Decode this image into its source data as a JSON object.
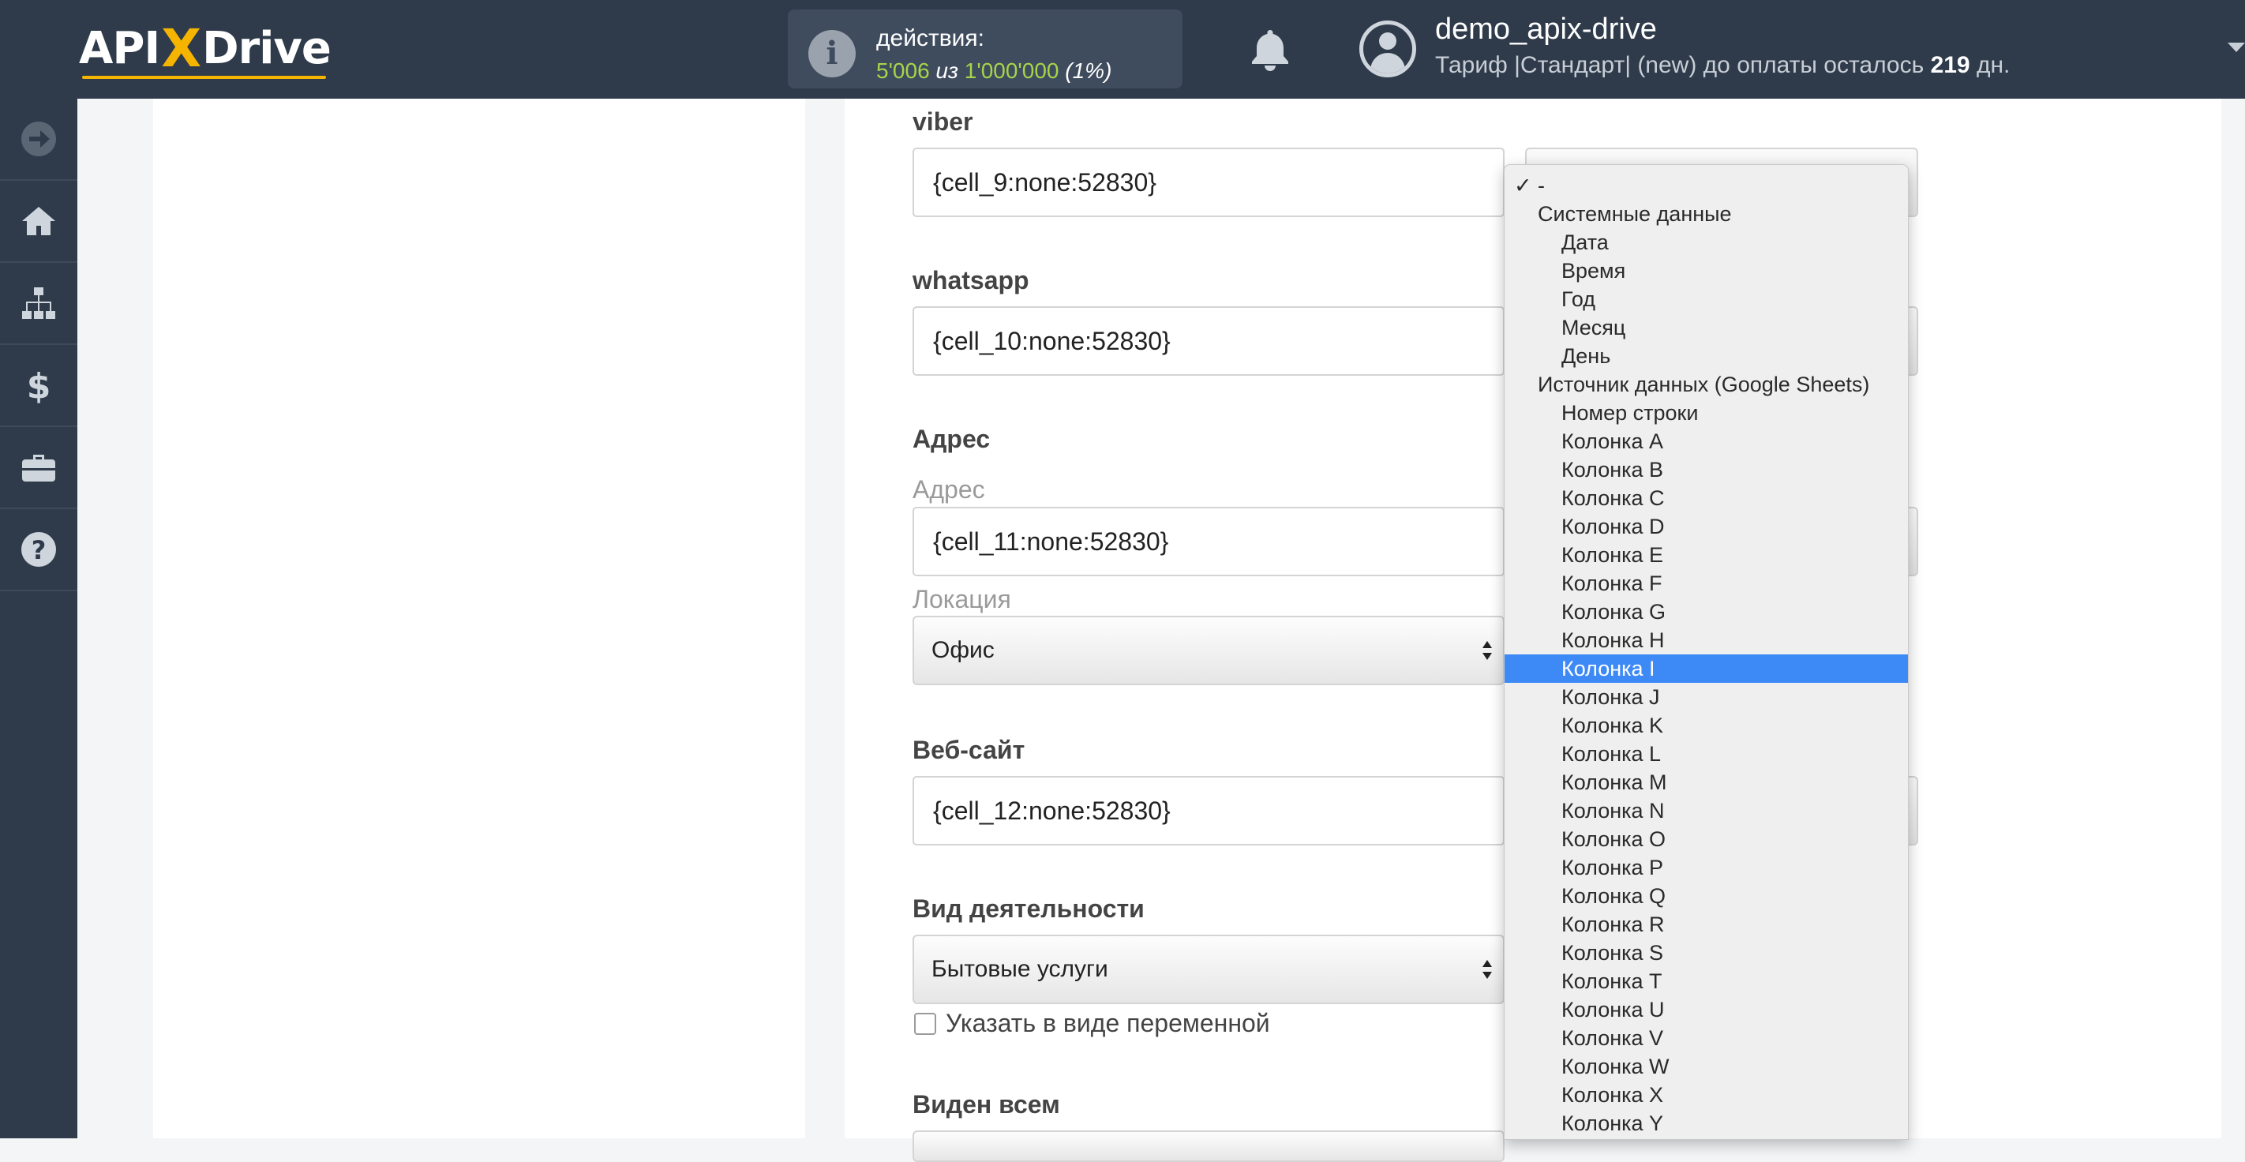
{
  "header": {
    "logo": {
      "part1": "API",
      "x": "X",
      "part2": "Drive"
    },
    "actions": {
      "label": "действия:",
      "used": "5'006",
      "of": "из",
      "total": "1'000'000",
      "percent": "(1%)"
    },
    "user": {
      "name": "demo_apix-drive",
      "plan_prefix": "Тариф |Стандарт| (new) до оплаты осталось",
      "days": "219",
      "days_suffix": "дн."
    }
  },
  "sidebar": {
    "items": [
      {
        "icon": "arrow-right-circle-icon"
      },
      {
        "icon": "home-icon"
      },
      {
        "icon": "sitemap-icon"
      },
      {
        "icon": "dollar-icon"
      },
      {
        "icon": "briefcase-icon"
      },
      {
        "icon": "help-circle-icon"
      }
    ]
  },
  "form": {
    "viber": {
      "label": "viber",
      "value": "{cell_9:none:52830}"
    },
    "whatsapp": {
      "label": "whatsapp",
      "value": "{cell_10:none:52830}"
    },
    "address": {
      "section": "Адрес",
      "label": "Адрес",
      "value": "{cell_11:none:52830}"
    },
    "location": {
      "label": "Локация",
      "value": "Офис"
    },
    "website": {
      "label": "Веб-сайт",
      "value": "{cell_12:none:52830}"
    },
    "activity": {
      "label": "Вид деятельности",
      "value": "Бытовые услуги",
      "checkbox_label": "Указать в виде переменной"
    },
    "visible": {
      "label": "Виден всем"
    }
  },
  "dropdown": {
    "checked_option": "-",
    "groups": [
      {
        "label": "Системные данные",
        "items": [
          "Дата",
          "Время",
          "Год",
          "Месяц",
          "День"
        ]
      },
      {
        "label": "Источник данных (Google Sheets)",
        "items": [
          "Номер строки",
          "Колонка A",
          "Колонка B",
          "Колонка C",
          "Колонка D",
          "Колонка E",
          "Колонка F",
          "Колонка G",
          "Колонка H",
          "Колонка I",
          "Колонка J",
          "Колонка K",
          "Колонка L",
          "Колонка M",
          "Колонка N",
          "Колонка O",
          "Колонка P",
          "Колонка Q",
          "Колонка R",
          "Колонка S",
          "Колонка T",
          "Колонка U",
          "Колонка V",
          "Колонка W",
          "Колонка X",
          "Колонка Y"
        ]
      }
    ],
    "highlighted": "Колонка I"
  },
  "colors": {
    "header_bg": "#2f3b4b",
    "accent": "#f5b400",
    "used_actions": "#a7d44a",
    "highlight": "#3d8af7"
  }
}
